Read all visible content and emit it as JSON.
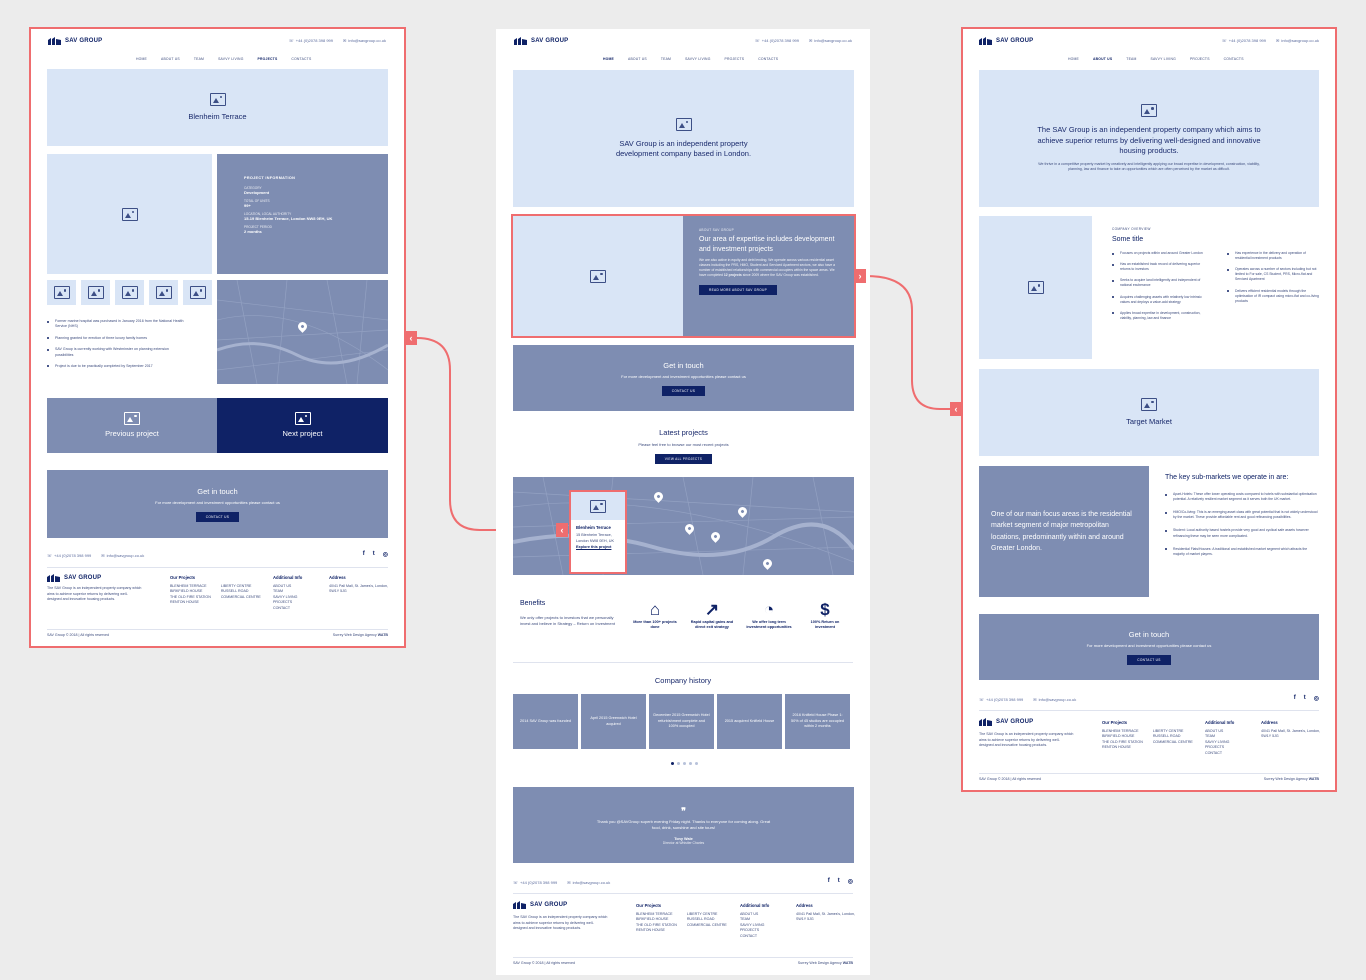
{
  "brand": {
    "name": "SAV GROUP",
    "phone": "+44 (0)2078 398 999",
    "email": "info@savgroup.co.uk"
  },
  "nav": [
    "HOME",
    "ABOUT US",
    "TEAM",
    "SAVVY LIVING",
    "PROJECTS",
    "CONTACTS"
  ],
  "project_page": {
    "hero": "Blenheim Terrace",
    "info": {
      "heading": "PROJECT INFORMATION",
      "category_label": "CATEGORY",
      "category": "Development",
      "units_label": "TOTAL OF UNITS",
      "units": "99+",
      "location_label": "LOCATION, LOCAL AUTHORITY",
      "location": "15-19 Blenheim Terrace, London NW8 0EH, UK",
      "period_label": "PROJECT PERIOD",
      "period": "2 months"
    },
    "bullets": [
      "Former marine hospital was purchased in January 2016 from the National Health Service (NHS)",
      "Planning granted for erection of three luxury family homes",
      "SAV Group is currently working with Westminster on planning extension possibilities",
      "Project is due to be practically completed by September 2017"
    ],
    "prev": "Previous project",
    "next": "Next project"
  },
  "get_in_touch": {
    "title": "Get in touch",
    "text": "For more development and investment opportunities please contact us",
    "button": "CONTACT US"
  },
  "home_page": {
    "hero": "SAV Group is an independent property development company based in London.",
    "about": {
      "label": "ABOUT SAV GROUP",
      "title": "Our area of expertise includes development and investment projects",
      "text": "We are also active in equity and debt lending. We operate across various residential asset classes including the PRS, HMO, Student and Serviced Apartment sectors, we also have a number of established relationships with commercial occupiers within the space areas. We have completed",
      "text_strong": "12 projects",
      "text_end": "since 2009 where the SAV Group was established.",
      "button": "READ MORE ABOUT SAV GROUP"
    },
    "latest": {
      "title": "Latest projects",
      "text": "Please feel free to browse our most recent projects",
      "button": "VIEW ALL PROJECTS"
    },
    "map_card": {
      "title": "Blenheim Terrace",
      "line1": "15 Blenheim Terrace,",
      "line2": "London NW8 0EH, UK",
      "link": "Explore this project"
    },
    "benefits": {
      "title": "Benefits",
      "text": "We only offer projects to investors that we personally invest and believe in Strategy – Return on Investment",
      "items": [
        {
          "icon": "home-icon",
          "label": "More than 100+ projects done"
        },
        {
          "icon": "growth-chart-icon",
          "label": "Rapid capital gains and direct exit strategy"
        },
        {
          "icon": "pie-chart-icon",
          "label": "We offer long term investment opportunities"
        },
        {
          "icon": "dollar-growth-icon",
          "label": "100% Return on investment"
        }
      ]
    },
    "history": {
      "title": "Company history",
      "items": [
        "2014 SAV Group was founded",
        "April 2015 Greenwich Hotel acquired",
        "December 2015 Greenwich Hotel refurbishment complete and 100% occupied",
        "2015 acquired Knifield House",
        "2016 Knifield House Phase 1: 50% of 45 studios are occupied within 2 months"
      ]
    },
    "testimonial": {
      "text": "Thank you @SAVGroup superb evening Friday night. Thanks to everyone for coming along. Great food, drink, sunshine and site tours!",
      "name": "Tony Wale",
      "role": "Director at Whistler Charles"
    }
  },
  "about_page": {
    "hero_title": "The SAV Group is an independent property company which aims to achieve superior returns by delivering well-designed and innovative housing products.",
    "hero_text": "We thrive in a competitive property market by creatively and intelligently applying our broad expertise in development, construction, viability, planning, law and finance to take on opportunities which are often perceived by the market as difficult.",
    "overview_label": "COMPANY OVERVIEW",
    "overview_title": "Some title",
    "col1": [
      "Focuses on projects within and around Greater London",
      "Has an established track record of delivering superior returns to investors",
      "Seeks to acquire land intelligently and independent of national exuberance",
      "Acquires challenging assets with relatively low intrinsic values and deploys a value-add strategy",
      "Applies broad expertise in development, construction, viability, planning, law and finance"
    ],
    "col2": [
      "Has experience in the delivery and operation of residential investment products",
      "Operates across a number of sectors including but not limited to For sale, CS Student, PRS, Micro-flat and Serviced Apartment",
      "Delivers efficient residential models through the optimisation of IR compact using micro-flat and co-living products"
    ],
    "target": "Target Market",
    "focus": "One of our main focus areas is the residential market segment of major metropolitan locations, predominantly within and around Greater London.",
    "sub_title": "The key sub-markets we operate in are:",
    "sub": [
      "Apart-Hotels: These offer lower operating costs compared to hotels with substantial optimisation potential. A relatively resilient market segment as it serves both the UK market.",
      "HMO/Co-living: This is an emerging asset class with great potential that is not widely understood by the market. These provide affordable rent and good refinancing possibilities.",
      "Student: Local authority based hostels provide very good and cyclical safe assets however refinancing these may be seen more complicated.",
      "Residential Flats/Houses: A traditional and established market segment which attracts the majority of market players."
    ]
  },
  "footer": {
    "about": "The SAV Group is an independent property company which aims to achieve superior returns by delivering well-designed and innovative housing products.",
    "projects_title": "Our Projects",
    "projects_a": [
      "BLENHEIM TERRACE",
      "BIRKFIELD HOUSE",
      "THE OLD FIRE STATION",
      "RENTON HOUSE"
    ],
    "projects_b": [
      "LIBERTY CENTRE",
      "RUSSELL ROAD",
      "COMMERCIAL CENTRE"
    ],
    "info_title": "Additional Info",
    "info": [
      "ABOUT US",
      "TEAM",
      "SAVVY LIVING",
      "PROJECTS",
      "CONTACT"
    ],
    "address_title": "Address",
    "address": "40/41 Pall Mall, St. James's, London, SW1Y 5JG",
    "copyright": "SAV Group © 2018 | All rights reserved",
    "agency": "Surrey Web Design Agency",
    "agency_strong": "WATB"
  },
  "colors": {
    "accent": "#ef6d6f",
    "navy": "#0f2266",
    "mid": "#7e8db2",
    "light": "#d9e5f6"
  }
}
